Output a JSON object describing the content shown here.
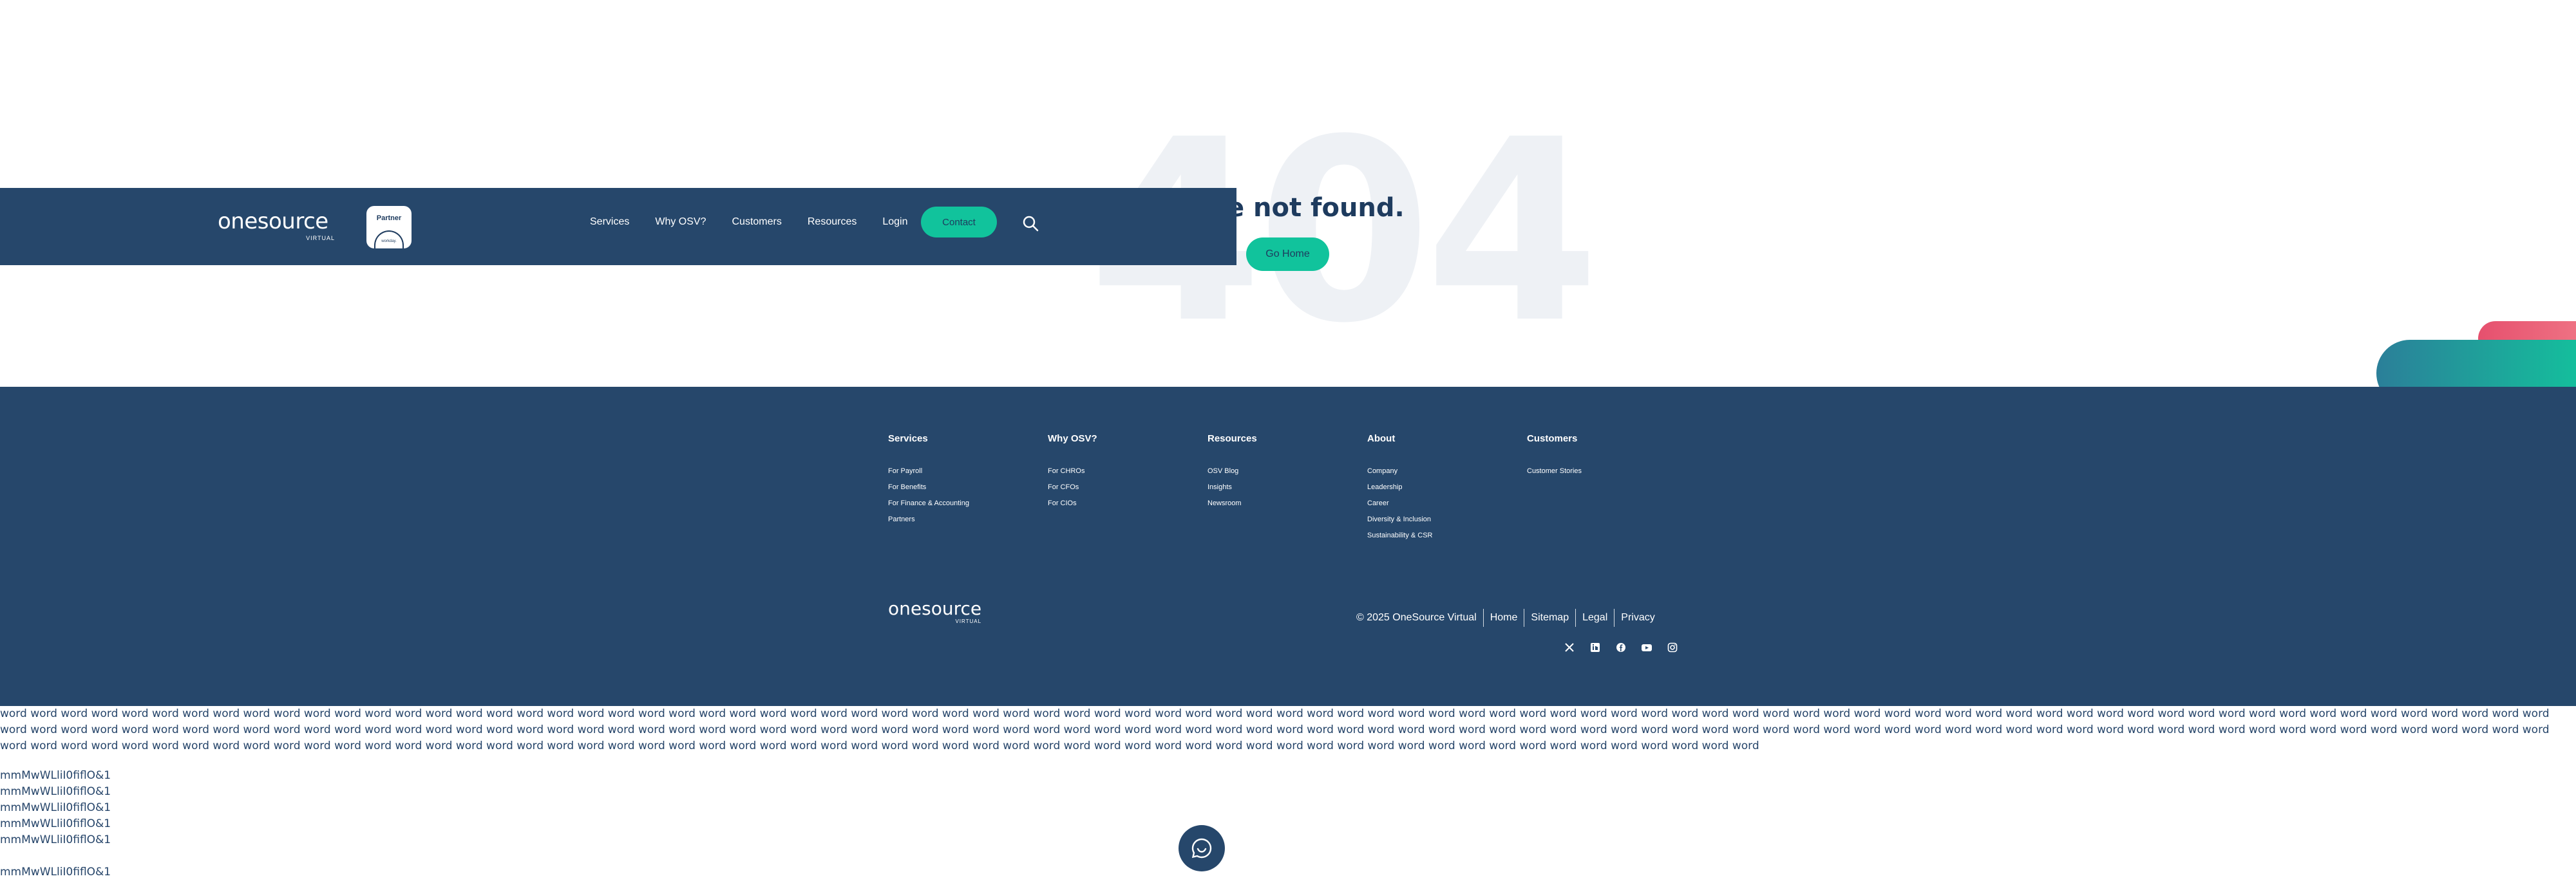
{
  "hero": {
    "big_number": "404",
    "message": "e not found.",
    "button_label": "Go Home"
  },
  "header": {
    "logo_word": "onesource",
    "logo_sub": "VIRTUAL",
    "partner_label": "Partner",
    "partner_sub": "workday.",
    "nav": [
      "Services",
      "Why OSV?",
      "Customers",
      "Resources",
      "Login"
    ],
    "contact_label": "Contact"
  },
  "footer": {
    "columns": [
      {
        "title": "Services",
        "links": [
          "For Payroll",
          "For Benefits",
          "For Finance & Accounting",
          "Partners"
        ]
      },
      {
        "title": "Why OSV?",
        "links": [
          "For CHROs",
          "For CFOs",
          "For CIOs"
        ]
      },
      {
        "title": "Resources",
        "links": [
          "OSV Blog",
          "Insights",
          "Newsroom"
        ]
      },
      {
        "title": "About",
        "links": [
          "Company",
          "Leadership",
          "Career",
          "Diversity & Inclusion",
          "Sustainability & CSR"
        ]
      },
      {
        "title": "Customers",
        "links": [
          "Customer Stories"
        ]
      }
    ],
    "logo_word": "onesource",
    "logo_sub": "VIRTUAL",
    "copyright": "© 2025 OneSource Virtual",
    "legal_links": [
      "Home",
      "Sitemap",
      "Legal",
      "Privacy"
    ],
    "social_icons": [
      "x-icon",
      "linkedin-icon",
      "facebook-icon",
      "youtube-icon",
      "instagram-icon"
    ]
  },
  "test_text": {
    "words": "word word word word word word word word word word word word word word word word word word word word word word word word word word word word word word word word word word word word word word word word word word word word word word word word word word word word word word word word word word word word word word word word word word word word word word word word word word word word word word word word word word word word word word word word word word word word word word word word word word word word word word word word word word word word word word word word word word word word word word word word word word word word word word word word word word word word word word word word word word word word word word word word word word word word word word word word word word word word word word word word word word word word word word word word word word word word word word word word word word word word word word word word word word word word word word word word word word word word word word word word word word word word word word word word word word word word word word word word word word word word word word word word word word",
    "glyph_line": "mmMwWLliI0fiflO&1"
  },
  "colors": {
    "navy": "#26476b",
    "teal": "#11c39c",
    "pink": "#e6506e"
  }
}
